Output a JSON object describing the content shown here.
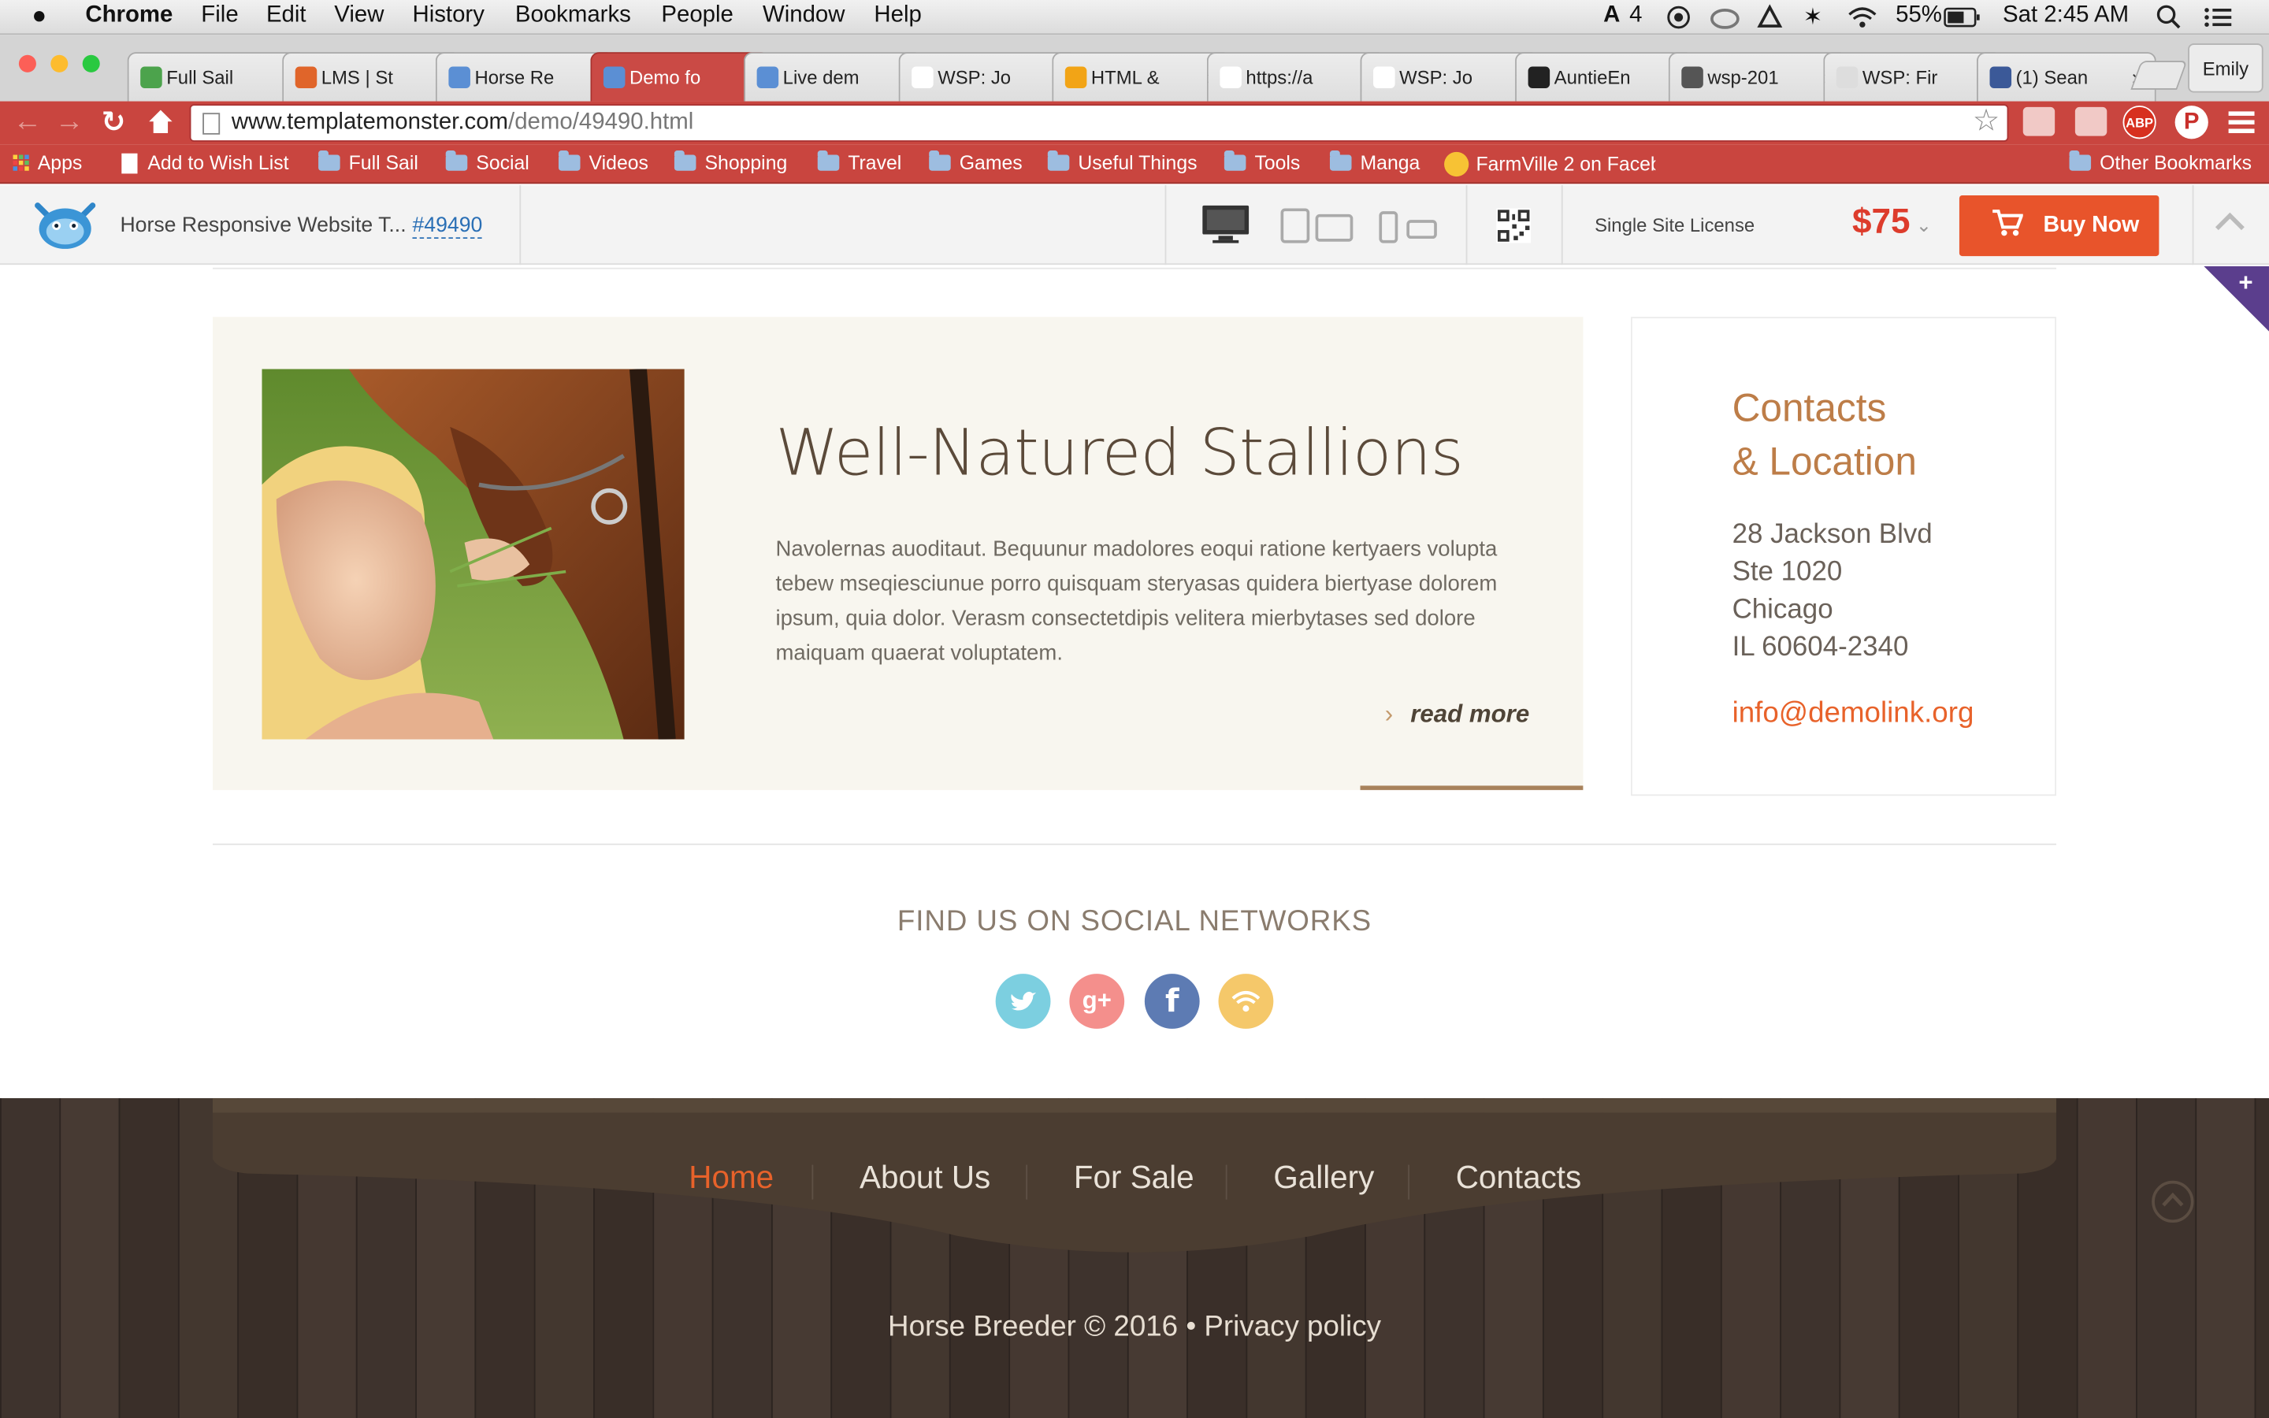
{
  "menubar": {
    "apple": "",
    "app_name": "Chrome",
    "items": [
      "File",
      "Edit",
      "View",
      "History",
      "Bookmarks",
      "People",
      "Window",
      "Help"
    ],
    "status": {
      "adobe_count": "4",
      "battery": "55%",
      "clock": "Sat 2:45 AM"
    }
  },
  "browser": {
    "profile": "Emily",
    "tabs": [
      {
        "title": "Full Sail",
        "color": "#4ca34c"
      },
      {
        "title": "LMS | St",
        "color": "#e0652a"
      },
      {
        "title": "Horse Re",
        "color": "#5b8fd4"
      },
      {
        "title": "Demo fo",
        "color": "#5b8fd4"
      },
      {
        "title": "Live dem",
        "color": "#5b8fd4"
      },
      {
        "title": "WSP: Jo",
        "color": "#ffffff"
      },
      {
        "title": "HTML &",
        "color": "#f2a416"
      },
      {
        "title": "https://a",
        "color": "#ffffff"
      },
      {
        "title": "WSP: Jo",
        "color": "#ffffff"
      },
      {
        "title": "AuntieEn",
        "color": "#222222"
      },
      {
        "title": "wsp-201",
        "color": "#555555"
      },
      {
        "title": "WSP: Fir",
        "color": "#dddddd"
      },
      {
        "title": "(1) Sean",
        "color": "#3b5998"
      }
    ],
    "url_host": "www.templatemonster.com",
    "url_path": "/demo/49490.html",
    "bookmarks": [
      "Apps",
      "Add to Wish List",
      "Full Sail",
      "Social",
      "Videos",
      "Shopping",
      "Travel",
      "Games",
      "Useful Things",
      "Tools",
      "Manga",
      "FarmVille 2 on Faceb",
      "Other Bookmarks"
    ],
    "extensions": {
      "abp": "ABP"
    }
  },
  "demobar": {
    "title": "Horse Responsive Website T...",
    "template_id": "#49490",
    "license": "Single Site License",
    "price": "$75",
    "buy_label": "Buy Now",
    "accent": "#e8542b"
  },
  "article": {
    "title": "Well-Natured Stallions",
    "body": "Navolernas auoditaut. Bequunur madolores eoqui ratione kertyaers volupta tebew mseqiesciunue porro quisquam steryasas quidera biertyase dolorem ipsum, quia dolor. Verasm consectetdipis velitera mierbytases sed dolore maiquam quaerat voluptatem.",
    "read_more": "read more",
    "readmore_arrow": "›"
  },
  "contacts": {
    "title": "Contacts\n& Location",
    "address": [
      "28 Jackson Blvd",
      "Ste 1020",
      "Chicago",
      "IL 60604-2340"
    ],
    "email": "info@demolink.org"
  },
  "social": {
    "heading": "FIND US ON SOCIAL NETWORKS",
    "icons": [
      {
        "name": "twitter-icon",
        "color": "#7ccfe0",
        "glyph": ""
      },
      {
        "name": "google-plus-icon",
        "color": "#f48f8c",
        "glyph": "g+"
      },
      {
        "name": "facebook-icon",
        "color": "#5d7bb3",
        "glyph": "f"
      },
      {
        "name": "rss-icon",
        "color": "#f5c86a",
        "glyph": ""
      }
    ]
  },
  "footer": {
    "nav": [
      {
        "label": "Home",
        "active": true
      },
      {
        "label": "About Us",
        "active": false
      },
      {
        "label": "For Sale",
        "active": false
      },
      {
        "label": "Gallery",
        "active": false
      },
      {
        "label": "Contacts",
        "active": false
      }
    ],
    "active_color": "#e8622a",
    "copyright": "Horse Breeder © 2016 • Privacy policy"
  }
}
